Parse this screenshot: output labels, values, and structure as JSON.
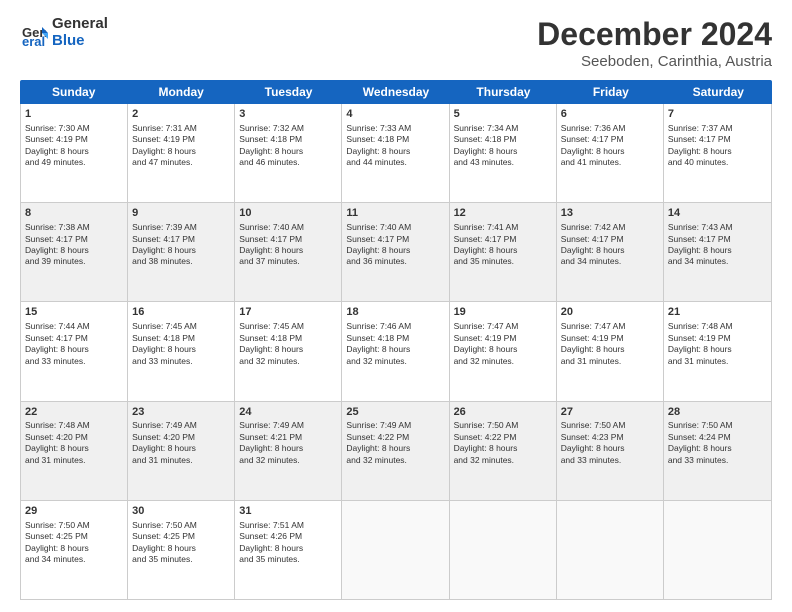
{
  "logo": {
    "line1": "General",
    "line2": "Blue"
  },
  "title": "December 2024",
  "subtitle": "Seeboden, Carinthia, Austria",
  "header_days": [
    "Sunday",
    "Monday",
    "Tuesday",
    "Wednesday",
    "Thursday",
    "Friday",
    "Saturday"
  ],
  "weeks": [
    [
      {
        "day": "1",
        "lines": [
          "Sunrise: 7:30 AM",
          "Sunset: 4:19 PM",
          "Daylight: 8 hours",
          "and 49 minutes."
        ]
      },
      {
        "day": "2",
        "lines": [
          "Sunrise: 7:31 AM",
          "Sunset: 4:19 PM",
          "Daylight: 8 hours",
          "and 47 minutes."
        ]
      },
      {
        "day": "3",
        "lines": [
          "Sunrise: 7:32 AM",
          "Sunset: 4:18 PM",
          "Daylight: 8 hours",
          "and 46 minutes."
        ]
      },
      {
        "day": "4",
        "lines": [
          "Sunrise: 7:33 AM",
          "Sunset: 4:18 PM",
          "Daylight: 8 hours",
          "and 44 minutes."
        ]
      },
      {
        "day": "5",
        "lines": [
          "Sunrise: 7:34 AM",
          "Sunset: 4:18 PM",
          "Daylight: 8 hours",
          "and 43 minutes."
        ]
      },
      {
        "day": "6",
        "lines": [
          "Sunrise: 7:36 AM",
          "Sunset: 4:17 PM",
          "Daylight: 8 hours",
          "and 41 minutes."
        ]
      },
      {
        "day": "7",
        "lines": [
          "Sunrise: 7:37 AM",
          "Sunset: 4:17 PM",
          "Daylight: 8 hours",
          "and 40 minutes."
        ]
      }
    ],
    [
      {
        "day": "8",
        "lines": [
          "Sunrise: 7:38 AM",
          "Sunset: 4:17 PM",
          "Daylight: 8 hours",
          "and 39 minutes."
        ]
      },
      {
        "day": "9",
        "lines": [
          "Sunrise: 7:39 AM",
          "Sunset: 4:17 PM",
          "Daylight: 8 hours",
          "and 38 minutes."
        ]
      },
      {
        "day": "10",
        "lines": [
          "Sunrise: 7:40 AM",
          "Sunset: 4:17 PM",
          "Daylight: 8 hours",
          "and 37 minutes."
        ]
      },
      {
        "day": "11",
        "lines": [
          "Sunrise: 7:40 AM",
          "Sunset: 4:17 PM",
          "Daylight: 8 hours",
          "and 36 minutes."
        ]
      },
      {
        "day": "12",
        "lines": [
          "Sunrise: 7:41 AM",
          "Sunset: 4:17 PM",
          "Daylight: 8 hours",
          "and 35 minutes."
        ]
      },
      {
        "day": "13",
        "lines": [
          "Sunrise: 7:42 AM",
          "Sunset: 4:17 PM",
          "Daylight: 8 hours",
          "and 34 minutes."
        ]
      },
      {
        "day": "14",
        "lines": [
          "Sunrise: 7:43 AM",
          "Sunset: 4:17 PM",
          "Daylight: 8 hours",
          "and 34 minutes."
        ]
      }
    ],
    [
      {
        "day": "15",
        "lines": [
          "Sunrise: 7:44 AM",
          "Sunset: 4:17 PM",
          "Daylight: 8 hours",
          "and 33 minutes."
        ]
      },
      {
        "day": "16",
        "lines": [
          "Sunrise: 7:45 AM",
          "Sunset: 4:18 PM",
          "Daylight: 8 hours",
          "and 33 minutes."
        ]
      },
      {
        "day": "17",
        "lines": [
          "Sunrise: 7:45 AM",
          "Sunset: 4:18 PM",
          "Daylight: 8 hours",
          "and 32 minutes."
        ]
      },
      {
        "day": "18",
        "lines": [
          "Sunrise: 7:46 AM",
          "Sunset: 4:18 PM",
          "Daylight: 8 hours",
          "and 32 minutes."
        ]
      },
      {
        "day": "19",
        "lines": [
          "Sunrise: 7:47 AM",
          "Sunset: 4:19 PM",
          "Daylight: 8 hours",
          "and 32 minutes."
        ]
      },
      {
        "day": "20",
        "lines": [
          "Sunrise: 7:47 AM",
          "Sunset: 4:19 PM",
          "Daylight: 8 hours",
          "and 31 minutes."
        ]
      },
      {
        "day": "21",
        "lines": [
          "Sunrise: 7:48 AM",
          "Sunset: 4:19 PM",
          "Daylight: 8 hours",
          "and 31 minutes."
        ]
      }
    ],
    [
      {
        "day": "22",
        "lines": [
          "Sunrise: 7:48 AM",
          "Sunset: 4:20 PM",
          "Daylight: 8 hours",
          "and 31 minutes."
        ]
      },
      {
        "day": "23",
        "lines": [
          "Sunrise: 7:49 AM",
          "Sunset: 4:20 PM",
          "Daylight: 8 hours",
          "and 31 minutes."
        ]
      },
      {
        "day": "24",
        "lines": [
          "Sunrise: 7:49 AM",
          "Sunset: 4:21 PM",
          "Daylight: 8 hours",
          "and 32 minutes."
        ]
      },
      {
        "day": "25",
        "lines": [
          "Sunrise: 7:49 AM",
          "Sunset: 4:22 PM",
          "Daylight: 8 hours",
          "and 32 minutes."
        ]
      },
      {
        "day": "26",
        "lines": [
          "Sunrise: 7:50 AM",
          "Sunset: 4:22 PM",
          "Daylight: 8 hours",
          "and 32 minutes."
        ]
      },
      {
        "day": "27",
        "lines": [
          "Sunrise: 7:50 AM",
          "Sunset: 4:23 PM",
          "Daylight: 8 hours",
          "and 33 minutes."
        ]
      },
      {
        "day": "28",
        "lines": [
          "Sunrise: 7:50 AM",
          "Sunset: 4:24 PM",
          "Daylight: 8 hours",
          "and 33 minutes."
        ]
      }
    ],
    [
      {
        "day": "29",
        "lines": [
          "Sunrise: 7:50 AM",
          "Sunset: 4:25 PM",
          "Daylight: 8 hours",
          "and 34 minutes."
        ]
      },
      {
        "day": "30",
        "lines": [
          "Sunrise: 7:50 AM",
          "Sunset: 4:25 PM",
          "Daylight: 8 hours",
          "and 35 minutes."
        ]
      },
      {
        "day": "31",
        "lines": [
          "Sunrise: 7:51 AM",
          "Sunset: 4:26 PM",
          "Daylight: 8 hours",
          "and 35 minutes."
        ]
      },
      null,
      null,
      null,
      null
    ]
  ]
}
